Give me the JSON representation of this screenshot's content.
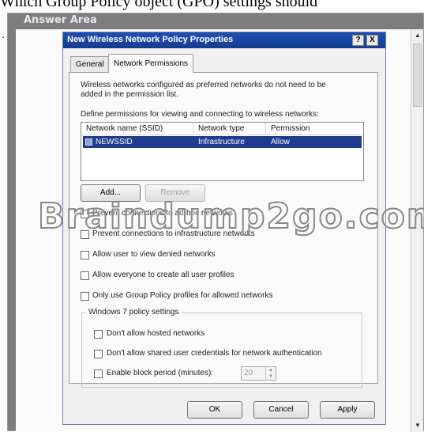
{
  "page": {
    "question_fragment": "Which Group Policy object (GPO) settings should",
    "left_mark": ".",
    "answer_area_title": "Answer Area"
  },
  "dialog": {
    "title": "New Wireless Network Policy Properties",
    "help_btn": "?",
    "close_btn": "X",
    "tabs": [
      "General",
      "Network Permissions"
    ],
    "active_tab": "Network Permissions",
    "intro_line1": "Wireless networks configured as preferred networks do not need to be",
    "intro_line2": "added in the permission list.",
    "define_label": "Define permissions for viewing and connecting to wireless networks:",
    "list": {
      "columns": [
        "Network name (SSID)",
        "Network type",
        "Permission"
      ],
      "rows": [
        {
          "ssid": "NEWSSID",
          "type": "Infrastructure",
          "permission": "Allow",
          "selected": true
        }
      ]
    },
    "add_btn": "Add...",
    "remove_btn": "Remove",
    "checkboxes": [
      {
        "label": "Prevent connections to ad-hoc networks",
        "checked": false
      },
      {
        "label": "Prevent connections to infrastructure networks",
        "checked": false
      },
      {
        "label": "Allow user to view denied networks",
        "checked": false
      },
      {
        "label": "Allow everyone to create all user profiles",
        "checked": false
      },
      {
        "label": "Only use Group Policy profiles for allowed networks",
        "checked": false
      }
    ],
    "group_title": "Windows 7 policy settings",
    "group_checkboxes": [
      {
        "label": "Don't allow hosted networks",
        "checked": false
      },
      {
        "label": "Don't allow shared user credentials for network authentication",
        "checked": false
      },
      {
        "label": "Enable block period (minutes):",
        "checked": false
      }
    ],
    "block_period_value": "20",
    "ok_btn": "OK",
    "cancel_btn": "Cancel",
    "apply_btn": "Apply"
  },
  "watermark": "Braindump2go.com",
  "colors": {
    "title_bar": "#1e4fb3",
    "selection": "#1f3c8f",
    "answer_area": "#7d7d7d"
  }
}
